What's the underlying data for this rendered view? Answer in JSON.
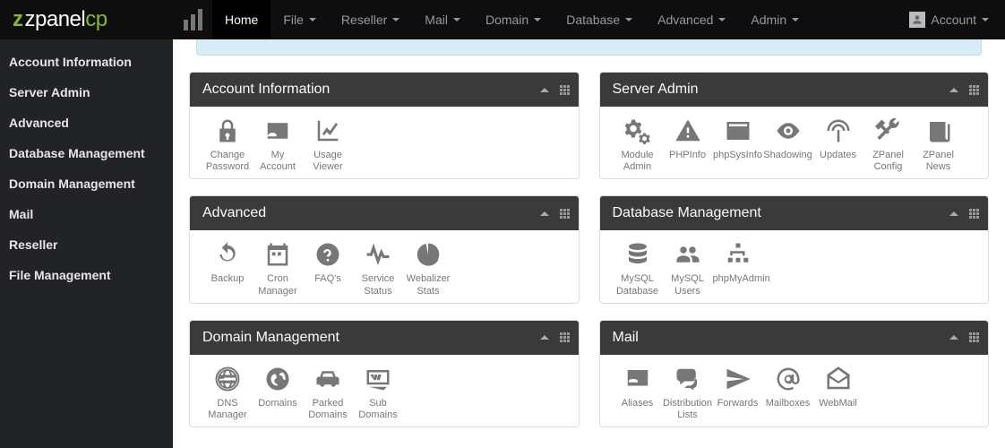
{
  "brand": {
    "z": "z",
    "name": "zpanel",
    "cp": "cp"
  },
  "topnav": {
    "home": "Home",
    "file": "File",
    "reseller": "Reseller",
    "mail": "Mail",
    "domain": "Domain",
    "database": "Database",
    "advanced": "Advanced",
    "admin": "Admin",
    "account": "Account"
  },
  "sidebar": {
    "items": [
      {
        "label": "Account Information"
      },
      {
        "label": "Server Admin"
      },
      {
        "label": "Advanced"
      },
      {
        "label": "Database Management"
      },
      {
        "label": "Domain Management"
      },
      {
        "label": "Mail"
      },
      {
        "label": "Reseller"
      },
      {
        "label": "File Management"
      }
    ]
  },
  "panels": {
    "account_info": {
      "title": "Account Information",
      "modules": [
        {
          "label": "Change Password",
          "icon": "lock"
        },
        {
          "label": "My Account",
          "icon": "id-card"
        },
        {
          "label": "Usage Viewer",
          "icon": "chart-line"
        }
      ]
    },
    "server_admin": {
      "title": "Server Admin",
      "modules": [
        {
          "label": "Module Admin",
          "icon": "gears"
        },
        {
          "label": "PHPInfo",
          "icon": "warning"
        },
        {
          "label": "phpSysInfo",
          "icon": "terminal"
        },
        {
          "label": "Shadowing",
          "icon": "eye"
        },
        {
          "label": "Updates",
          "icon": "broadcast"
        },
        {
          "label": "ZPanel Config",
          "icon": "tools"
        },
        {
          "label": "ZPanel News",
          "icon": "news"
        }
      ]
    },
    "advanced": {
      "title": "Advanced",
      "modules": [
        {
          "label": "Backup",
          "icon": "refresh"
        },
        {
          "label": "Cron Manager",
          "icon": "calendar"
        },
        {
          "label": "FAQ's",
          "icon": "question"
        },
        {
          "label": "Service Status",
          "icon": "pulse"
        },
        {
          "label": "Webalizer Stats",
          "icon": "pie"
        }
      ]
    },
    "database": {
      "title": "Database Management",
      "modules": [
        {
          "label": "MySQL Database",
          "icon": "db"
        },
        {
          "label": "MySQL Users",
          "icon": "users"
        },
        {
          "label": "phpMyAdmin",
          "icon": "sitemap"
        }
      ]
    },
    "domain": {
      "title": "Domain Management",
      "modules": [
        {
          "label": "DNS Manager",
          "icon": "globe"
        },
        {
          "label": "Domains",
          "icon": "world"
        },
        {
          "label": "Parked Domains",
          "icon": "car"
        },
        {
          "label": "Sub Domains",
          "icon": "www"
        }
      ]
    },
    "mail": {
      "title": "Mail",
      "modules": [
        {
          "label": "Aliases",
          "icon": "contact"
        },
        {
          "label": "Distribution Lists",
          "icon": "chats"
        },
        {
          "label": "Forwards",
          "icon": "send"
        },
        {
          "label": "Mailboxes",
          "icon": "at"
        },
        {
          "label": "WebMail",
          "icon": "envelope-open"
        }
      ]
    }
  }
}
